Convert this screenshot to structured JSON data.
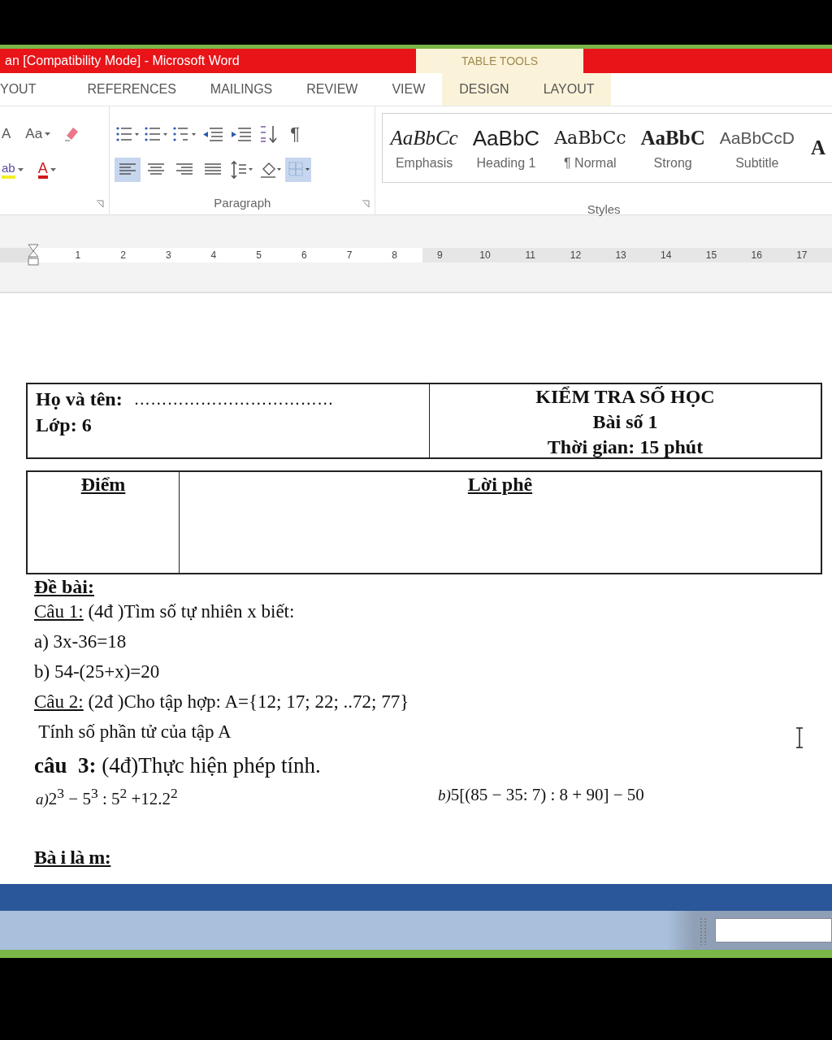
{
  "window": {
    "title": "an [Compatibility Mode] -  Microsoft Word",
    "context_group": "TABLE TOOLS"
  },
  "tabs": [
    {
      "label": "YOUT",
      "contextual": false
    },
    {
      "label": "REFERENCES",
      "contextual": false
    },
    {
      "label": "MAILINGS",
      "contextual": false
    },
    {
      "label": "REVIEW",
      "contextual": false
    },
    {
      "label": "VIEW",
      "contextual": false
    },
    {
      "label": "DESIGN",
      "contextual": true
    },
    {
      "label": "LAYOUT",
      "contextual": true
    }
  ],
  "font_group": {
    "row1": [
      {
        "kind": "grow",
        "label": "A",
        "selected": false
      },
      {
        "kind": "case",
        "label": "Aa",
        "selected": false
      },
      {
        "kind": "eraser",
        "selected": false
      }
    ],
    "row2": [
      {
        "kind": "highlight",
        "label": "ab",
        "selected": false
      },
      {
        "kind": "fontcolor",
        "label": "A",
        "selected": false
      }
    ]
  },
  "paragraph_group": {
    "label": "Paragraph",
    "row1": [
      {
        "kind": "bullets",
        "selected": false
      },
      {
        "kind": "numbering",
        "selected": false
      },
      {
        "kind": "multilevel",
        "selected": false
      },
      {
        "kind": "outdent",
        "selected": false
      },
      {
        "kind": "indent",
        "selected": false
      },
      {
        "kind": "sort",
        "selected": false
      },
      {
        "kind": "pilcrow",
        "label": "¶",
        "selected": false
      }
    ],
    "row2": [
      {
        "kind": "align-left",
        "selected": true
      },
      {
        "kind": "align-center",
        "selected": false
      },
      {
        "kind": "align-right",
        "selected": false
      },
      {
        "kind": "justify",
        "selected": false
      },
      {
        "kind": "spacing",
        "selected": false
      },
      {
        "kind": "shading",
        "selected": false
      },
      {
        "kind": "borders",
        "selected": true
      }
    ]
  },
  "styles_group": {
    "label": "Styles",
    "items": [
      {
        "kind": "emphasis",
        "preview": "AaBbCс",
        "name": "Emphasis"
      },
      {
        "kind": "heading",
        "preview": "AaBbC",
        "name": "Heading 1"
      },
      {
        "kind": "normal",
        "preview": "AaBbCс",
        "name": "¶ Normal"
      },
      {
        "kind": "strong",
        "preview": "AaBbC",
        "name": "Strong"
      },
      {
        "kind": "subtitle",
        "preview": "AaBbCcD",
        "name": "Subtitle"
      },
      {
        "kind": "partial",
        "preview": "A"
      }
    ]
  },
  "ruler": {
    "numbers": [
      "1",
      "2",
      "3",
      "4",
      "5",
      "6",
      "7",
      "8",
      "9",
      "10",
      "11",
      "12",
      "13",
      "14",
      "15",
      "16",
      "17"
    ]
  },
  "document": {
    "header_table": {
      "left": [
        {
          "label": "Họ và tên:",
          "dots": "………………………………"
        },
        {
          "label": "Lớp: 6"
        }
      ],
      "right": [
        "KIỂM TRA SỐ HỌC",
        "Bài số 1",
        "Thời gian: 15 phút"
      ]
    },
    "score_table": {
      "columns": [
        "Điểm",
        "Lời phê"
      ]
    },
    "heading": "Đề bài:",
    "lines": [
      {
        "kind": "question",
        "label": "Câu 1:",
        "text": " (4đ )Tìm số tự nhiên x biết:"
      },
      {
        "kind": "plain",
        "text": "a) 3x-36=18"
      },
      {
        "kind": "plain",
        "text": "b) 54-(25+x)=20"
      },
      {
        "kind": "question",
        "label": "Câu 2:",
        "text": " (2đ )Cho tập hợp: A={12; 17; 22; ..72; 77}"
      },
      {
        "kind": "plain",
        "text": " Tính số phần tử của tập A"
      },
      {
        "kind": "bold-question",
        "label": "câu  3:",
        "text": " (4đ)Thực hiện phép tính."
      }
    ],
    "formulas": [
      {
        "label": "a)",
        "expr": "2$^{3}$ − 5$^{3}$ : 5$^{2}$ +12.2$^{2}$"
      },
      {
        "label": "b)",
        "expr": "5[(85 − 35: 7) : 8 + 90] − 50"
      }
    ],
    "answer_heading": "Bà i là m:"
  }
}
